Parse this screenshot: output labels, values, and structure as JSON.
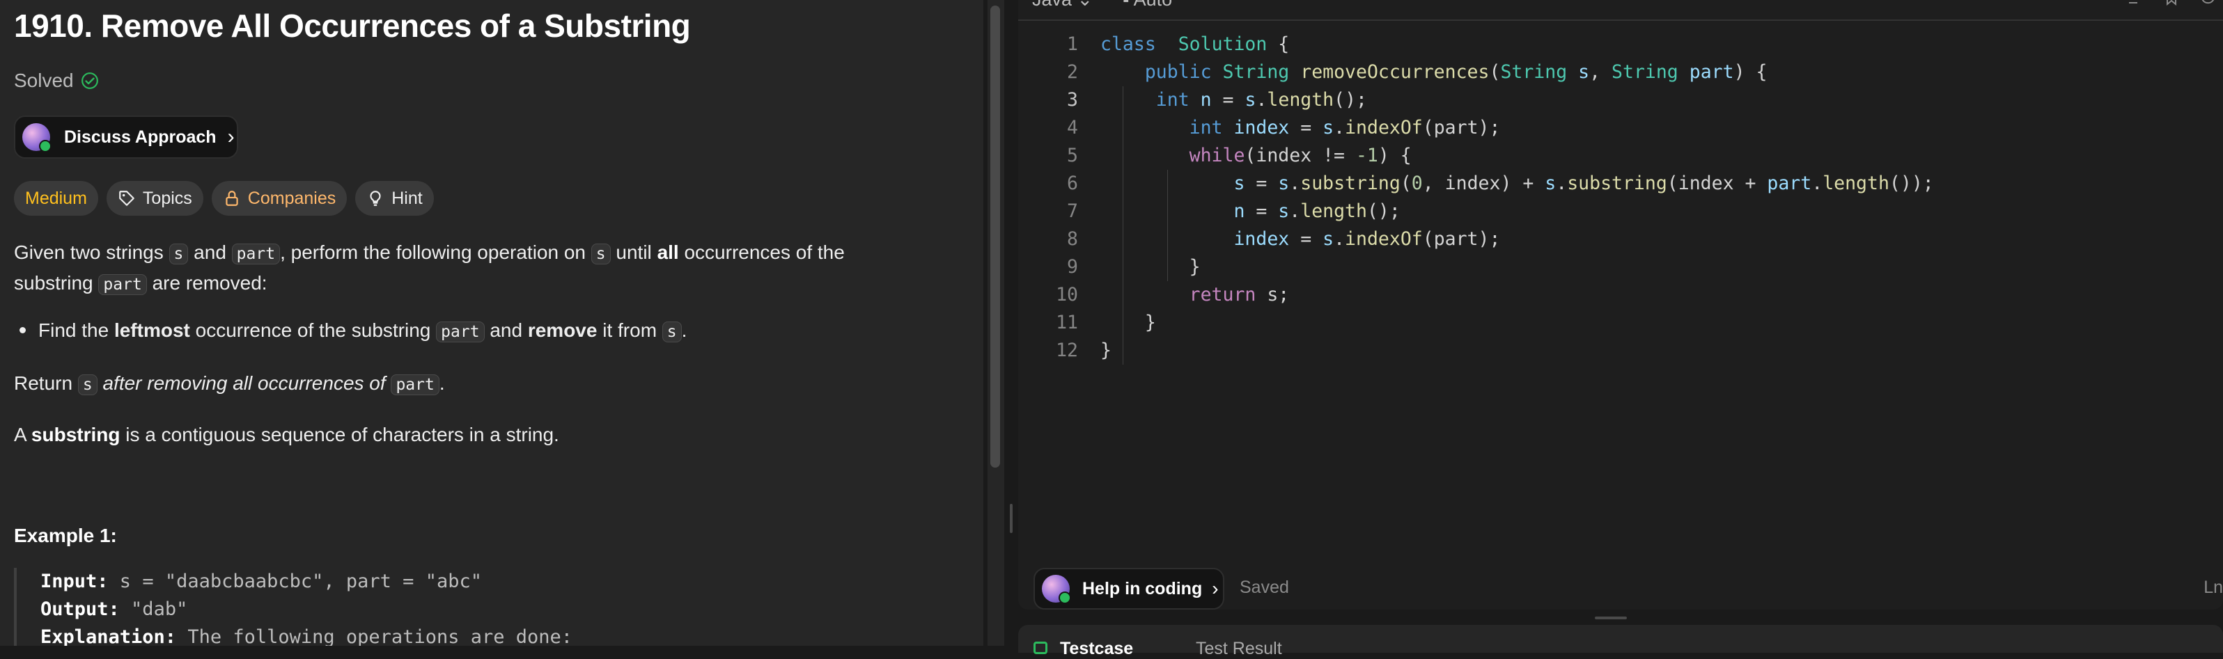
{
  "problem": {
    "title": "1910. Remove All Occurrences of a Substring",
    "status": "Solved",
    "discuss_label": "Discuss Approach",
    "tags": {
      "difficulty": "Medium",
      "topics": "Topics",
      "companies": "Companies",
      "hint": "Hint"
    },
    "p1": {
      "t1": "Given two strings ",
      "c1": "s",
      "t2": " and ",
      "c2": "part",
      "t3": ", perform the following operation on ",
      "c3": "s",
      "t4": " until ",
      "b1": "all",
      "t5": " occurrences of the substring ",
      "c4": "part",
      "t6": " are removed:"
    },
    "bullet": {
      "t1": "Find the ",
      "b1": "leftmost",
      "t2": " occurrence of the substring ",
      "c1": "part",
      "t3": " and ",
      "b2": "remove",
      "t4": " it from ",
      "c2": "s",
      "t5": "."
    },
    "p2": {
      "t1": "Return ",
      "c1": "s",
      "i1": " after removing all occurrences of ",
      "c2": "part",
      "t2": "."
    },
    "p3": {
      "t1": "A ",
      "b1": "substring",
      "t2": " is a contiguous sequence of characters in a string."
    },
    "example": {
      "title": "Example 1:",
      "input_label": "Input:",
      "input_value": " s = \"daabcbaabcbc\", part = \"abc\"",
      "output_label": "Output:",
      "output_value": " \"dab\"",
      "explanation_label": "Explanation:",
      "explanation_value": " The following operations are done:"
    }
  },
  "editor": {
    "language": "Java",
    "mode": "Auto",
    "saved_label": "Saved",
    "help_label": "Help in coding",
    "position_label": "Ln",
    "line_numbers": [
      "1",
      "2",
      "3",
      "4",
      "5",
      "6",
      "7",
      "8",
      "9",
      "10",
      "11",
      "12"
    ],
    "lines": [
      [
        [
          "kw",
          "class"
        ],
        [
          "",
          "  "
        ],
        [
          "ty",
          "Solution"
        ],
        [
          "",
          " {"
        ]
      ],
      [
        [
          "",
          "    "
        ],
        [
          "kw",
          "public"
        ],
        [
          "",
          " "
        ],
        [
          "ty",
          "String"
        ],
        [
          "",
          " "
        ],
        [
          "fn",
          "removeOccurrences"
        ],
        [
          "",
          "("
        ],
        [
          "ty",
          "String"
        ],
        [
          "",
          " "
        ],
        [
          "vr",
          "s"
        ],
        [
          "",
          ", "
        ],
        [
          "ty",
          "String"
        ],
        [
          "",
          " "
        ],
        [
          "vr",
          "part"
        ],
        [
          "",
          ") {"
        ]
      ],
      [
        [
          "",
          "     "
        ],
        [
          "kw",
          "int"
        ],
        [
          "",
          " "
        ],
        [
          "vr",
          "n"
        ],
        [
          "",
          " = "
        ],
        [
          "vr",
          "s"
        ],
        [
          "",
          "."
        ],
        [
          "fn",
          "length"
        ],
        [
          "",
          "();"
        ]
      ],
      [
        [
          "",
          "        "
        ],
        [
          "kw",
          "int"
        ],
        [
          "",
          " "
        ],
        [
          "vr",
          "index"
        ],
        [
          "",
          " = "
        ],
        [
          "vr",
          "s"
        ],
        [
          "",
          "."
        ],
        [
          "fn",
          "indexOf"
        ],
        [
          "",
          "(part);"
        ]
      ],
      [
        [
          "",
          "        "
        ],
        [
          "ctl",
          "while"
        ],
        [
          "",
          "(index != "
        ],
        [
          "nm",
          "-1"
        ],
        [
          "",
          ") {"
        ]
      ],
      [
        [
          "",
          "            "
        ],
        [
          "vr",
          "s"
        ],
        [
          "",
          " = "
        ],
        [
          "vr",
          "s"
        ],
        [
          "",
          "."
        ],
        [
          "fn",
          "substring"
        ],
        [
          "",
          "("
        ],
        [
          "nm",
          "0"
        ],
        [
          "",
          ", index) + "
        ],
        [
          "vr",
          "s"
        ],
        [
          "",
          "."
        ],
        [
          "fn",
          "substring"
        ],
        [
          "",
          "(index + "
        ],
        [
          "vr",
          "part"
        ],
        [
          "",
          "."
        ],
        [
          "fn",
          "length"
        ],
        [
          "",
          "());"
        ]
      ],
      [
        [
          "",
          "            "
        ],
        [
          "vr",
          "n"
        ],
        [
          "",
          " = "
        ],
        [
          "vr",
          "s"
        ],
        [
          "",
          "."
        ],
        [
          "fn",
          "length"
        ],
        [
          "",
          "();"
        ]
      ],
      [
        [
          "",
          "            "
        ],
        [
          "vr",
          "index"
        ],
        [
          "",
          " = "
        ],
        [
          "vr",
          "s"
        ],
        [
          "",
          "."
        ],
        [
          "fn",
          "indexOf"
        ],
        [
          "",
          "(part);"
        ]
      ],
      [
        [
          "",
          "        }"
        ]
      ],
      [
        [
          "",
          "        "
        ],
        [
          "ctl",
          "return"
        ],
        [
          "",
          " s;"
        ]
      ],
      [
        [
          "",
          "    }"
        ]
      ],
      [
        [
          "",
          "}"
        ]
      ]
    ]
  },
  "bottom_panel": {
    "tab1": "Testcase",
    "tab2": "Test Result"
  },
  "colors": {
    "difficulty_medium": "#ffc01e",
    "solved_check": "#2cbb5d"
  }
}
